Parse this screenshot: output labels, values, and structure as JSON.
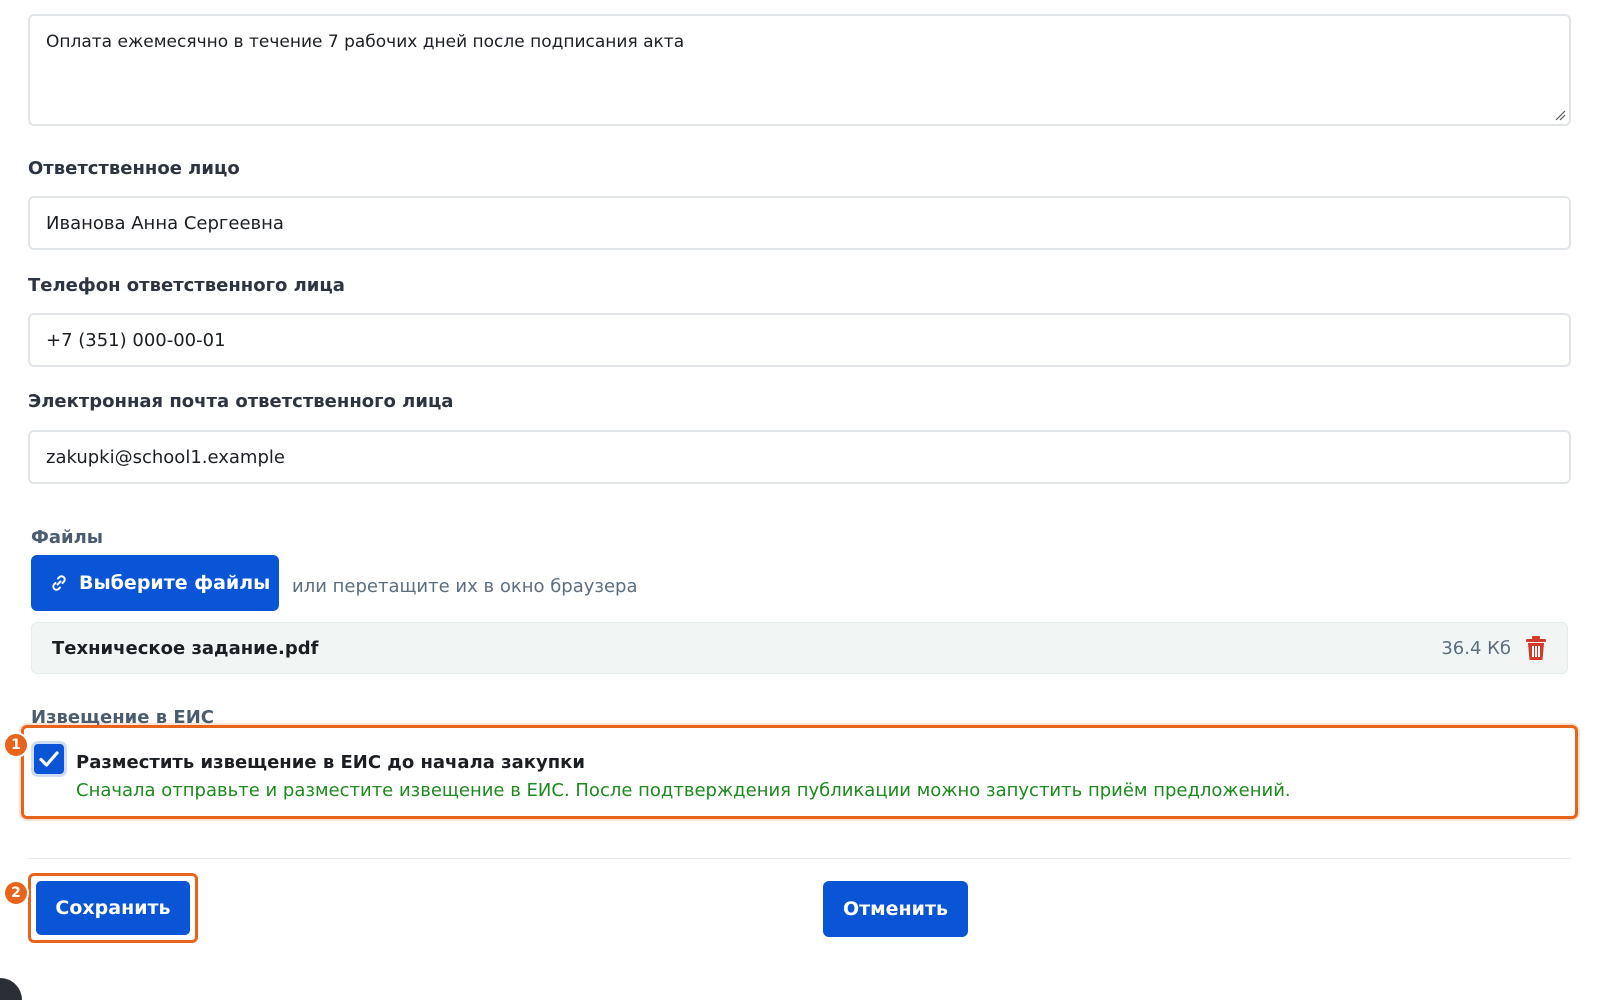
{
  "payment_terms": {
    "value": "Оплата ежемесячно в течение 7 рабочих дней после подписания акта"
  },
  "responsible_person": {
    "label": "Ответственное лицо",
    "value": "Иванова Анна Сергеевна"
  },
  "phone": {
    "label": "Телефон ответственного лица",
    "value": "+7 (351) 000-00-01"
  },
  "email": {
    "label": "Электронная почта ответственного лица",
    "value": "zakupki@school1.example"
  },
  "files": {
    "label": "Файлы",
    "choose_button": "Выберите файлы",
    "drop_hint": "или перетащите их в окно браузера",
    "items": [
      {
        "name": "Техническое задание.pdf",
        "size": "36.4 Кб"
      }
    ]
  },
  "eis": {
    "label": "Извещение в ЕИС",
    "checkbox_checked": true,
    "checkbox_label": "Разместить извещение в ЕИС до начала закупки",
    "description": "Сначала отправьте и разместите извещение в ЕИС. После подтверждения публикации можно запустить приём предложений."
  },
  "markers": [
    "1",
    "2"
  ],
  "actions": {
    "save": "Сохранить",
    "cancel": "Отменить"
  },
  "colors": {
    "primary": "#0a55d6",
    "highlight": "#e8641b",
    "success_text": "#1d8a1d",
    "delete": "#d43a2a"
  },
  "icons": {
    "choose_files": "link-icon",
    "delete_file": "trash-icon",
    "checkbox": "check-icon"
  }
}
